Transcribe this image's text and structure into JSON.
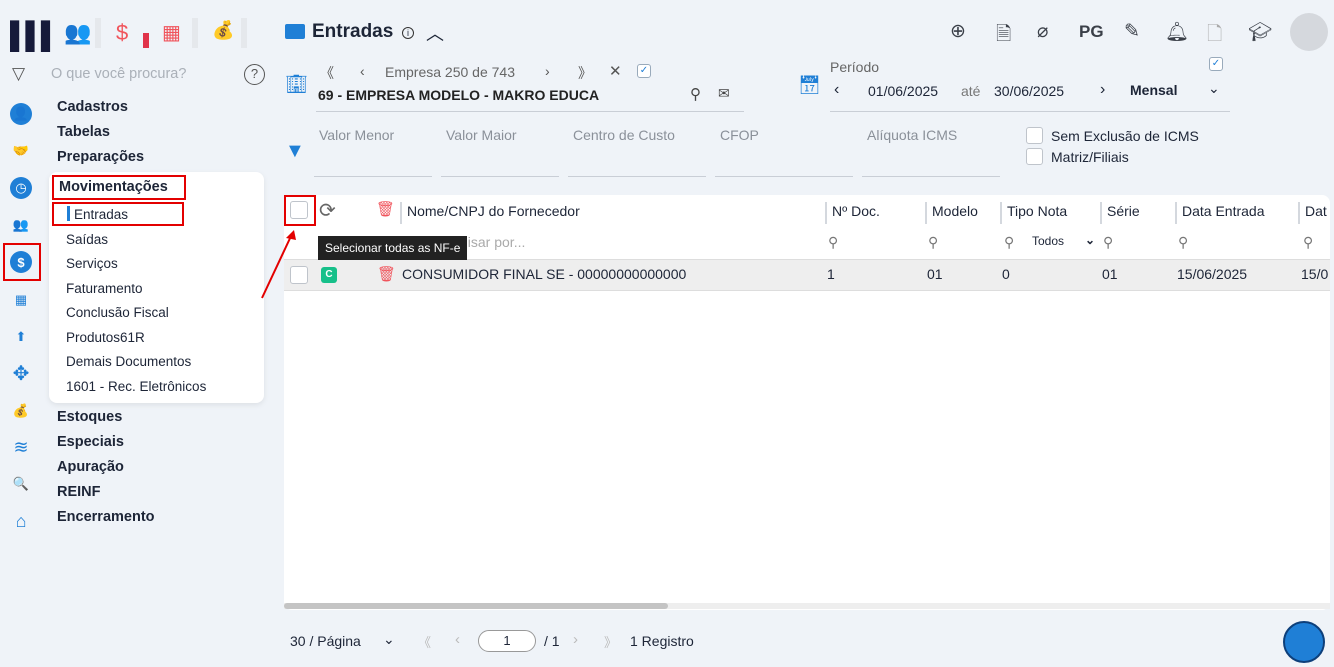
{
  "header": {
    "title": "Entradas",
    "info": "i"
  },
  "topbar_apps": [
    "people-icon",
    "dollar-icon",
    "calculator-icon",
    "money-bag-icon"
  ],
  "top_right": {
    "pg_label": "PG"
  },
  "search": {
    "placeholder": "O que você procura?"
  },
  "menu": {
    "items_before": [
      "Cadastros",
      "Tabelas",
      "Preparações"
    ],
    "active": "Movimentações",
    "sub": [
      "Entradas",
      "Saídas",
      "Serviços",
      "Faturamento",
      "Conclusão Fiscal",
      "Produtos61R",
      "Demais Documentos",
      "1601 - Rec. Eletrônicos"
    ],
    "items_after": [
      "Estoques",
      "Especiais",
      "Apuração",
      "REINF",
      "Encerramento"
    ]
  },
  "empresa": {
    "label": "Empresa",
    "current": "250",
    "de": "de",
    "total": "743",
    "name": "69 - EMPRESA MODELO - MAKRO EDUCA"
  },
  "periodo": {
    "label": "Período",
    "start": "01/06/2025",
    "ate": "até",
    "end": "30/06/2025",
    "mode": "Mensal"
  },
  "filters": {
    "valor_menor": "Valor Menor",
    "valor_maior": "Valor Maior",
    "centro_custo": "Centro de Custo",
    "cfop": "CFOP",
    "aliquota": "Alíquota ICMS",
    "sem_exclusao": "Sem Exclusão de ICMS",
    "matriz": "Matriz/Filiais"
  },
  "table": {
    "columns": [
      "Nome/CNPJ do Fornecedor",
      "Nº Doc.",
      "Modelo",
      "Tipo Nota",
      "Série",
      "Data Entrada",
      "Dat"
    ],
    "search_placeholder": "uisar por...",
    "tipo_filter": "Todos",
    "tooltip": "Selecionar todas as NF-e",
    "rows": [
      {
        "badge": "C",
        "nome": "CONSUMIDOR FINAL SE - 00000000000000",
        "doc": "1",
        "modelo": "01",
        "tipo": "0",
        "serie": "01",
        "data": "15/06/2025",
        "data2": "15/0"
      }
    ]
  },
  "pagination": {
    "per_page": "30 / Página",
    "page": "1",
    "of": "/ 1",
    "records": "1 Registro"
  },
  "colors": {
    "accent": "#1f7fd6",
    "highlight": "#e30000",
    "badge": "#17c08a"
  }
}
